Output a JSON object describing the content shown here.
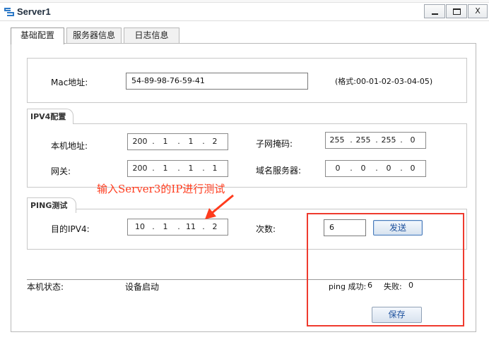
{
  "window": {
    "title": "Server1"
  },
  "tabs": [
    {
      "label": "基础配置",
      "active": true
    },
    {
      "label": "服务器信息",
      "active": false
    },
    {
      "label": "日志信息",
      "active": false
    }
  ],
  "mac": {
    "label": "Mac地址:",
    "value": "54-89-98-76-59-41",
    "hint": "(格式:00-01-02-03-04-05)"
  },
  "ipv4": {
    "section_title": "IPV4配置",
    "host_ip_label": "本机地址:",
    "host_ip": [
      "200",
      "1",
      "1",
      "2"
    ],
    "subnet_label": "子网掩码:",
    "subnet": [
      "255",
      "255",
      "255",
      "0"
    ],
    "gateway_label": "网关:",
    "gateway": [
      "200",
      "1",
      "1",
      "1"
    ],
    "dns_label": "域名服务器:",
    "dns": [
      "0",
      "0",
      "0",
      "0"
    ]
  },
  "ping": {
    "section_title": "PING测试",
    "target_label": "目的IPV4:",
    "target": [
      "10",
      "1",
      "11",
      "2"
    ],
    "count_label": "次数:",
    "count_value": "6",
    "send_button": "发送"
  },
  "status": {
    "label": "本机状态:",
    "value": "设备启动",
    "ping_success_label": "ping 成功:",
    "ping_success_count": "6",
    "fail_label": "失败:",
    "fail_count": "0"
  },
  "save_button": "保存",
  "annotation": {
    "text": "输入Server3的IP进行测试",
    "color": "#ff3b1d"
  },
  "colors": {
    "highlight_box": "#ef3a2e",
    "button_text": "#1b4f9c",
    "icon_blue": "#2d79c7"
  }
}
